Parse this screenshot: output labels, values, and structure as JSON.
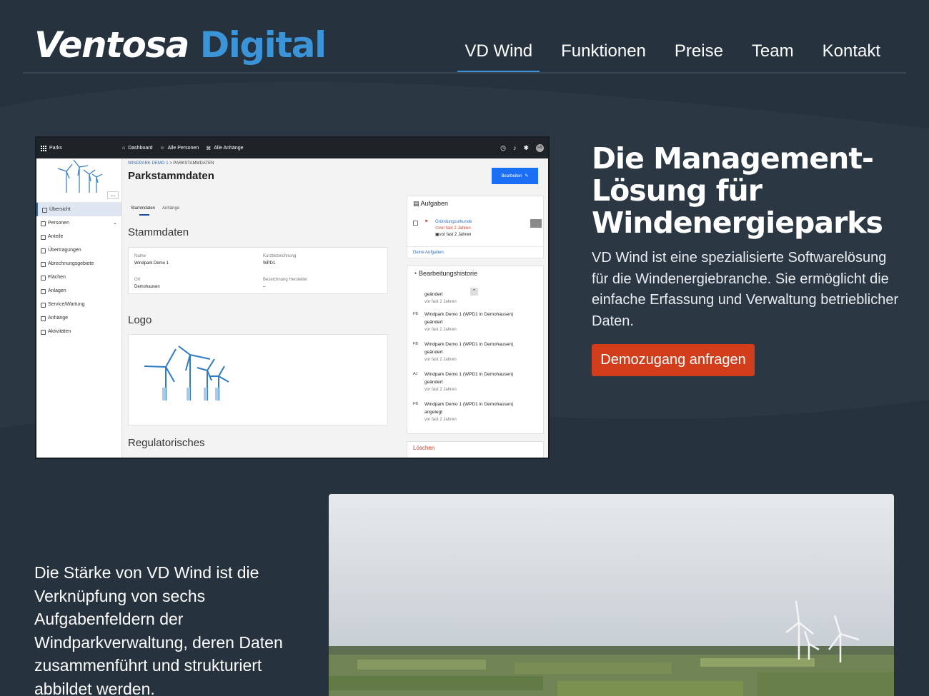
{
  "brand": {
    "part1": "Ventosa",
    "part2": "Digital"
  },
  "nav": [
    {
      "label": "VD Wind",
      "active": true
    },
    {
      "label": "Funktionen",
      "active": false
    },
    {
      "label": "Preise",
      "active": false
    },
    {
      "label": "Team",
      "active": false
    },
    {
      "label": "Kontakt",
      "active": false
    }
  ],
  "hero": {
    "title": "Die Management-Lösung für Windenergieparks",
    "description": "VD Wind ist eine spezialisierte Softwarelösung für die Windenergiebranche. Sie ermöglicht die einfache Erfassung und Verwaltung betrieblicher Daten.",
    "cta": "Demozugang anfragen"
  },
  "screenshot": {
    "topbar": {
      "parks": "Parks",
      "dashboard": "Dashboard",
      "persons": "Alle Personen",
      "attachments": "Alle Anhänge",
      "avatar": "FB"
    },
    "sidebar": [
      "Übersicht",
      "Personen",
      "Anteile",
      "Übertragungen",
      "Abrechnungsgebiete",
      "Flächen",
      "Anlagen",
      "Service/Wartung",
      "Anhänge",
      "Aktivitäten"
    ],
    "breadcrumb": {
      "link": "WINDPARK DEMO 1",
      "sep": " > ",
      "current": "PARKSTAMMDATEN"
    },
    "title": "Parkstammdaten",
    "edit_button": "Bearbeiten",
    "tabs": [
      "Stammdaten",
      "Anhänge"
    ],
    "section_stammdaten": "Stammdaten",
    "fields": [
      {
        "label": "Name",
        "value": "Windpark Demo 1"
      },
      {
        "label": "Kurzbezeichnung",
        "value": "WPD1"
      },
      {
        "label": "Ort",
        "value": "Demohausen"
      },
      {
        "label": "Bezeichnung Hersteller",
        "value": "–"
      }
    ],
    "section_logo": "Logo",
    "section_reg": "Regulatorisches",
    "tasks": {
      "header": "Aufgaben",
      "item_title": "Gründungsurkunde",
      "item_due": "vor fast 2 Jahren",
      "item_created": "vor fast 2 Jahren",
      "link": "Deine Aufgaben"
    },
    "history": {
      "header": "Bearbeitungshistorie",
      "items": [
        {
          "initials": "",
          "line1": "geändert",
          "line2": "",
          "time": "vor fast 2 Jahren"
        },
        {
          "initials": "FB",
          "line1": "Windpark Demo 1 (WPD1 in Demohausen)",
          "line2": "geändert",
          "time": "vor fast 2 Jahren"
        },
        {
          "initials": "FB",
          "line1": "Windpark Demo 1 (WPD1 in Demohausen)",
          "line2": "geändert",
          "time": "vor fast 2 Jahren"
        },
        {
          "initials": "AJ",
          "line1": "Windpark Demo 1 (WPD1 in Demohausen)",
          "line2": "geändert",
          "time": "vor fast 2 Jahren"
        },
        {
          "initials": "FB",
          "line1": "Windpark Demo 1 (WPD1 in Demohausen)",
          "line2": "angelegt",
          "time": "vor fast 2 Jahren"
        }
      ]
    },
    "delete": "Löschen"
  },
  "bottom": {
    "text": "Die Stärke von VD Wind ist die Verknüpfung von sechs Aufgabenfeldern der Windparkverwaltung, deren Daten zusammenführt und strukturiert abbildet werden."
  },
  "colors": {
    "background": "#26323d",
    "accent": "#3b93d8",
    "cta": "#d23d1c"
  }
}
